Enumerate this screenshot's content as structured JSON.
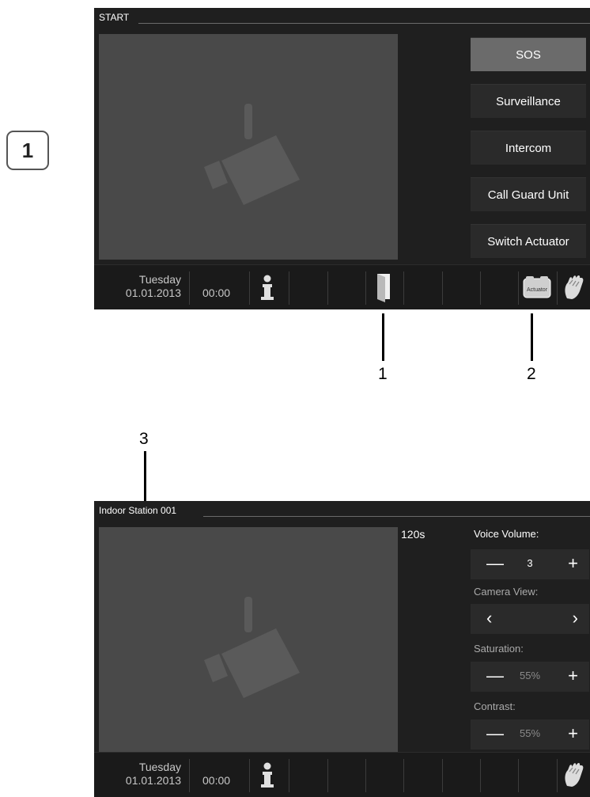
{
  "step_badge": "1",
  "screen1": {
    "title": "START",
    "menu": [
      "SOS",
      "Surveillance",
      "Intercom",
      "Call Guard Unit",
      "Switch Actuator"
    ],
    "footer": {
      "day": "Tuesday",
      "date": "01.01.2013",
      "time": "00:00",
      "actuator_icon_text": "Actuator"
    }
  },
  "screen2": {
    "title": "Indoor Station 001",
    "timer": "120s",
    "controls": {
      "voice_volume_label": "Voice Volume:",
      "voice_volume_value": "3",
      "camera_view_label": "Camera View:",
      "saturation_label": "Saturation:",
      "saturation_value": "55%",
      "contrast_label": "Contrast:",
      "contrast_value": "55%"
    },
    "footer": {
      "day": "Tuesday",
      "date": "01.01.2013",
      "time": "00:00"
    }
  },
  "callouts": {
    "one": "1",
    "two": "2",
    "three": "3"
  }
}
